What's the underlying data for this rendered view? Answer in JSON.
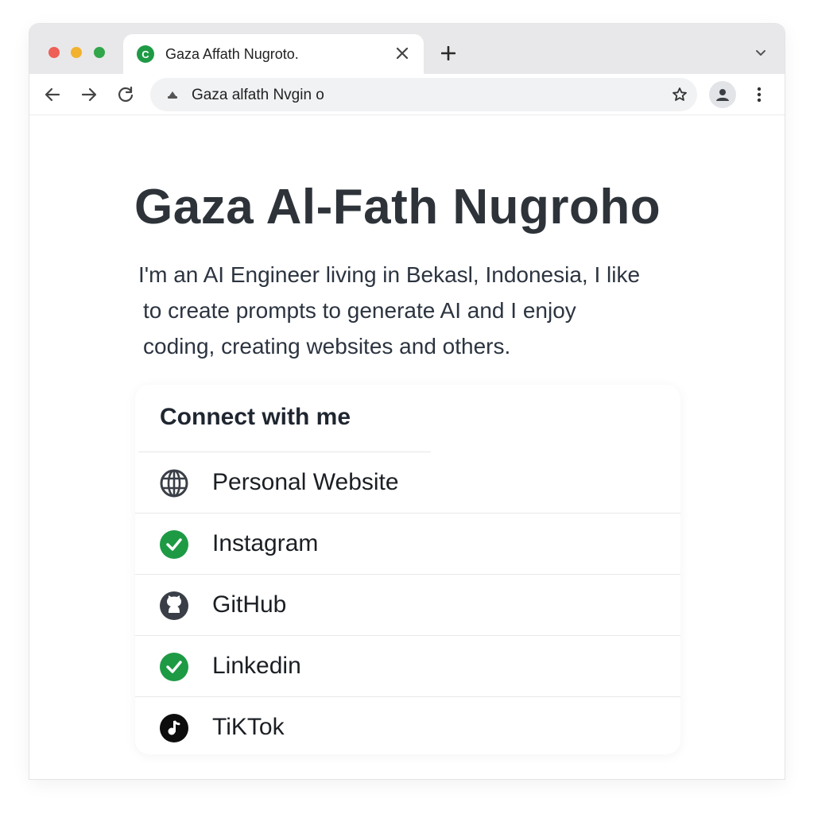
{
  "browser": {
    "tab": {
      "title": "Gaza Affath Nugroto.",
      "favicon_letter": "C",
      "favicon_color": "#1e9a45"
    },
    "address_bar": {
      "text": "Gaza alfath Nvgin o"
    }
  },
  "page": {
    "title": "Gaza Al-Fath Nugroho",
    "bio_lines": [
      "I'm an AI Engineer living in Bekasl, Indonesia, I like",
      "to create prompts to generate AI and I enjoy",
      "coding, creating websites and others."
    ],
    "connect": {
      "heading": "Connect with me",
      "links": [
        {
          "label": "Personal Website",
          "icon": "globe-icon"
        },
        {
          "label": "Instagram",
          "icon": "check-circle-icon"
        },
        {
          "label": "GitHub",
          "icon": "github-icon"
        },
        {
          "label": "Linkedin",
          "icon": "check-circle-icon"
        },
        {
          "label": "TiKTok",
          "icon": "tiktok-icon"
        }
      ]
    }
  },
  "colors": {
    "accent_green": "#1e9a45",
    "text_dark": "#2d3339",
    "traffic_red": "#ee5f58",
    "traffic_yellow": "#f2b22f",
    "traffic_green": "#31a64b"
  }
}
